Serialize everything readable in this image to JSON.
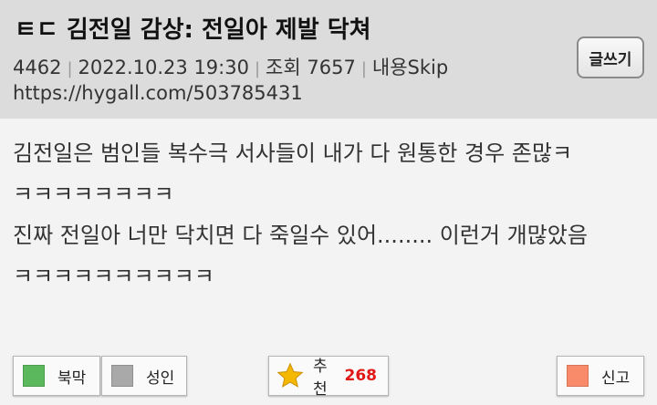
{
  "post": {
    "title": "ㅌㄷ 김전일 감상: 전일아 제발 닥쳐",
    "id": "4462",
    "datetime": "2022.10.23 19:30",
    "views_label": "조회 7657",
    "content_label": "내용Skip",
    "url": "https://hygall.com/503785431",
    "body_lines": [
      "김전일은 범인들 복수극 서사들이 내가 다 원통한 경우 존많ㅋ",
      "ㅋㅋㅋㅋㅋㅋㅋㅋ",
      "진짜 전일아 너만 닥치면 다 죽일수 있어........ 이런거 개많았음",
      "ㅋㅋㅋㅋㅋㅋㅋㅋㅋㅋ"
    ]
  },
  "toolbar": {
    "write_label": "글쓰기"
  },
  "actions": {
    "bookmark": {
      "label": "북막",
      "color": "#5cb85c"
    },
    "adult": {
      "label": "성인",
      "color": "#a9a9a9"
    },
    "recommend": {
      "label": "추천",
      "count": "268",
      "star_color": "#f5b800"
    },
    "report": {
      "label": "신고",
      "color": "#f98a6a"
    }
  }
}
